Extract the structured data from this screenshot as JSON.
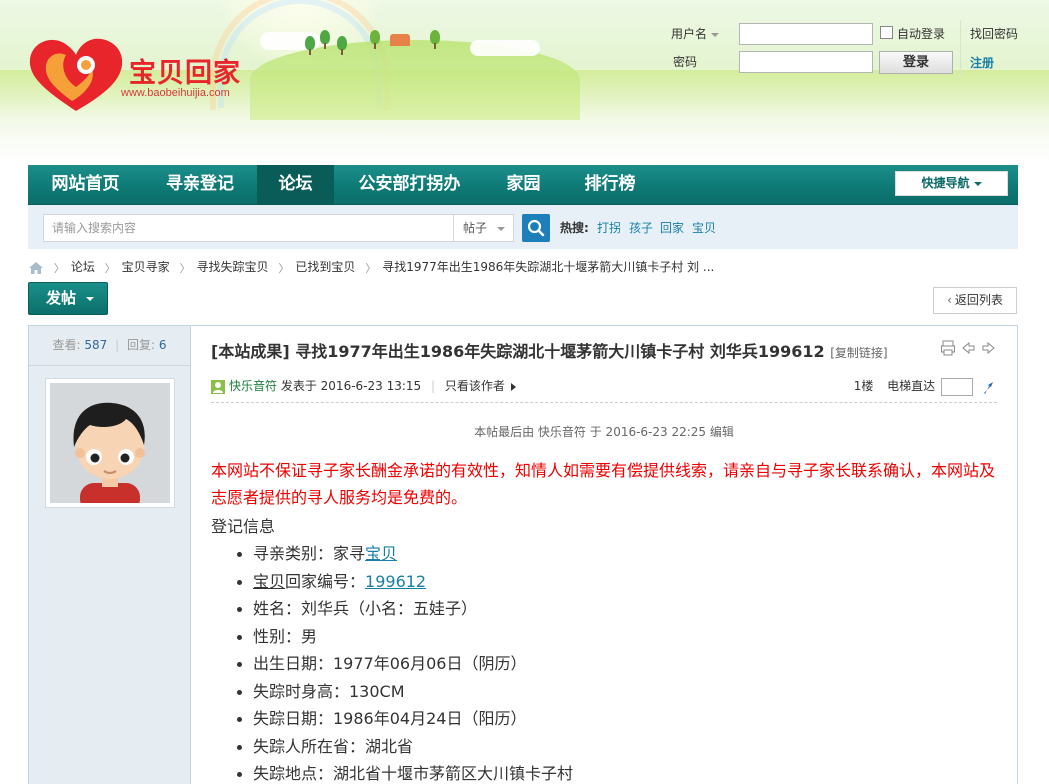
{
  "site": {
    "logo_text": "宝贝回家",
    "logo_url": "www.baobeihuijia.com"
  },
  "login": {
    "username_label": "用户名",
    "password_label": "密码",
    "auto_login_label": "自动登录",
    "login_button": "登录",
    "forgot_password": "找回密码",
    "register": "注册"
  },
  "nav": {
    "items": [
      {
        "label": "网站首页"
      },
      {
        "label": "寻亲登记"
      },
      {
        "label": "论坛"
      },
      {
        "label": "公安部打拐办"
      },
      {
        "label": "家园"
      },
      {
        "label": "排行榜"
      }
    ],
    "active_index": 2,
    "quick_nav": "快捷导航"
  },
  "search": {
    "placeholder": "请输入搜索内容",
    "type": "帖子",
    "hot_label": "热搜:",
    "hot_terms": [
      "打拐",
      "孩子",
      "回家",
      "宝贝"
    ]
  },
  "breadcrumb": [
    "论坛",
    "宝贝寻家",
    "寻找失踪宝贝",
    "已找到宝贝",
    "寻找1977年出生1986年失踪湖北十堰茅箭大川镇卡子村 刘 ..."
  ],
  "actions": {
    "post_button": "发帖",
    "back_button": "返回列表"
  },
  "stats": {
    "views_label": "查看:",
    "views": "587",
    "replies_label": "回复:",
    "replies": "6"
  },
  "post": {
    "title": "[本站成果] 寻找1977年出生1986年失踪湖北十堰茅箭大川镇卡子村 刘华兵199612",
    "copy_link": "[复制链接]",
    "author": "快乐音符",
    "posted_at": "发表于 2016-6-23 13:15",
    "only_author": "只看该作者",
    "floor": "1楼",
    "elevator": "电梯直达",
    "edited_note": "本帖最后由 快乐音符 于 2016-6-23 22:25 编辑",
    "notice": "本网站不保证寻子家长酬金承诺的有效性，知情人如需要有偿提供线索，请亲自与寻子家长联系确认，本网站及志愿者提供的寻人服务均是免费的。",
    "reg_title": "登记信息",
    "fields": {
      "category_label": "寻亲类别：家寻",
      "category_link": "宝贝",
      "id_label_link": "宝贝",
      "id_label_rest": "回家编号：",
      "id_value": "199612",
      "name": "姓名：刘华兵（小名：五娃子）",
      "gender": "性别：男",
      "birth": "出生日期：1977年06月06日（阴历）",
      "height": "失踪时身高：130CM",
      "missing_date": "失踪日期：1986年04月24日（阳历）",
      "province": "失踪人所在省：湖北省",
      "place": "失踪地点：湖北省十堰市茅箭区大川镇卡子村"
    }
  }
}
